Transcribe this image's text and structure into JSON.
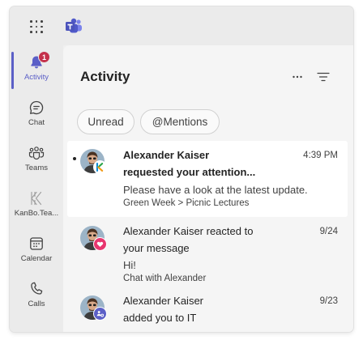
{
  "rail": {
    "activity": {
      "label": "Activity",
      "badge": "1"
    },
    "chat": {
      "label": "Chat"
    },
    "teams": {
      "label": "Teams"
    },
    "kanbo": {
      "label": "KanBo.Tea..."
    },
    "calendar": {
      "label": "Calendar"
    },
    "calls": {
      "label": "Calls"
    }
  },
  "header": {
    "title": "Activity",
    "more_label": "···"
  },
  "filters": [
    {
      "label": "Unread"
    },
    {
      "label": "@Mentions"
    }
  ],
  "feed": [
    {
      "sender": "Alexander Kaiser",
      "action": "requested your attention...",
      "time": "4:39 PM",
      "preview": "Please have a look at the latest update.",
      "context": "Green Week > Picnic Lectures",
      "unread": true,
      "badge_icon": "kanbo-icon"
    },
    {
      "title_line1": "Alexander Kaiser reacted to",
      "title_line2": "your message",
      "time": "9/24",
      "preview": "Hi!",
      "context": "Chat with Alexander",
      "unread": false,
      "badge_icon": "heart-icon"
    },
    {
      "title_line1": "Alexander Kaiser",
      "title_line2": "added you to IT",
      "time": "9/23",
      "unread": false,
      "badge_icon": "team-add-icon"
    }
  ],
  "colors": {
    "accent": "#5b5fc7",
    "badge_red": "#c4314b",
    "heart_pink": "#e8366f"
  }
}
